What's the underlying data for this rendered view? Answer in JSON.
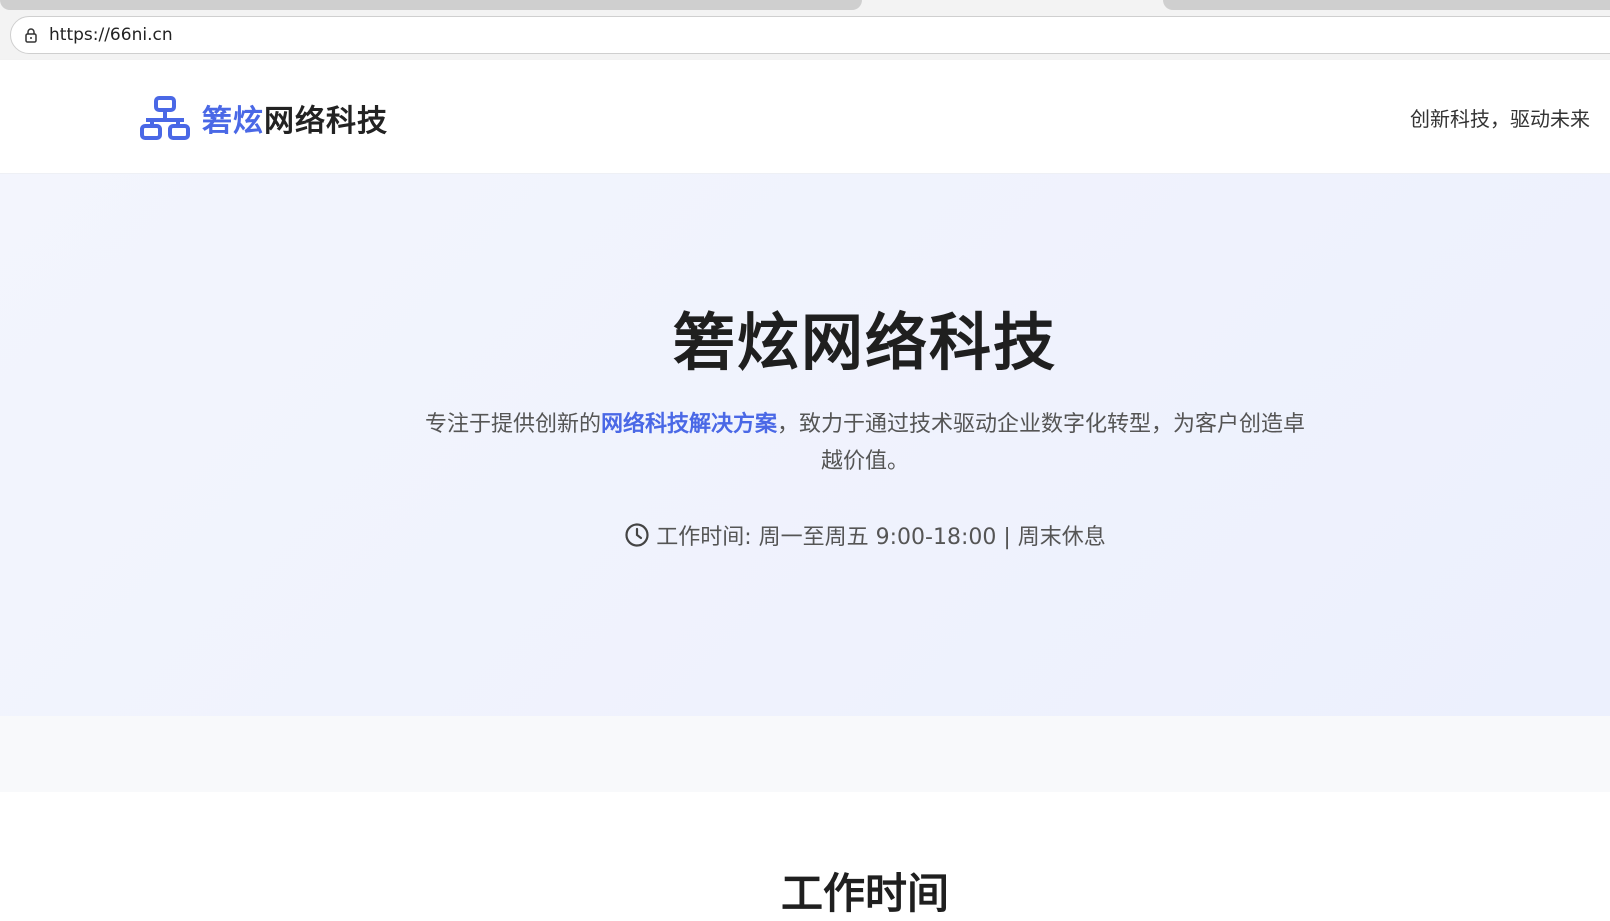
{
  "browser": {
    "url": "https://66ni.cn"
  },
  "header": {
    "logo_accent": "箬炫",
    "logo_rest": "网络科技",
    "tagline": "创新科技，驱动未来",
    "brand_color": "#4a68e6"
  },
  "hero": {
    "title": "箬炫网络科技",
    "desc_before": "专注于提供创新的",
    "desc_highlight": "网络科技解决方案",
    "desc_after": "，致力于通过技术驱动企业数字化转型，为客户创造卓越价值。",
    "hours": "工作时间: 周一至周五 9:00-18:00 | 周末休息"
  },
  "section": {
    "title": "工作时间"
  },
  "icons": {
    "lock": "lock-icon",
    "logo": "network-icon",
    "clock": "clock-icon"
  }
}
